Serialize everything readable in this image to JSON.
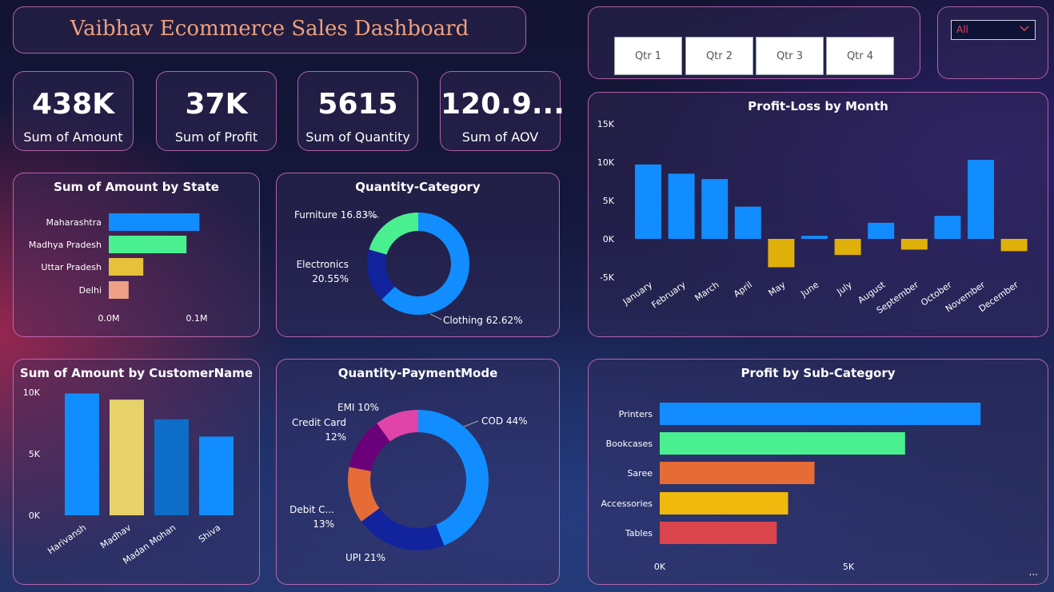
{
  "header": {
    "title": "Vaibhav Ecommerce Sales Dashboard"
  },
  "kpis": [
    {
      "value": "438K",
      "label": "Sum of Amount"
    },
    {
      "value": "37K",
      "label": "Sum of Profit"
    },
    {
      "value": "5615",
      "label": "Sum of Quantity"
    },
    {
      "value": "120.9...",
      "label": "Sum of AOV"
    }
  ],
  "quarters": [
    "Qtr 1",
    "Qtr 2",
    "Qtr 3",
    "Qtr 4"
  ],
  "filter": {
    "selected": "All"
  },
  "titles": {
    "state": "Sum of Amount by State",
    "category": "Quantity-Category",
    "month": "Profit-Loss by Month",
    "customer": "Sum of Amount by CustomerName",
    "payment": "Quantity-PaymentMode",
    "subcat": "Profit by Sub-Category"
  },
  "more_label": "...",
  "chart_data": [
    {
      "id": "state",
      "type": "bar",
      "orientation": "horizontal",
      "title": "Sum of Amount by State",
      "categories": [
        "Maharashtra",
        "Madhya Pradesh",
        "Uttar Pradesh",
        "Delhi"
      ],
      "values": [
        105000,
        90000,
        40000,
        23000
      ],
      "colors": [
        "#118dff",
        "#4af08f",
        "#e6c23a",
        "#eea187"
      ],
      "xticks": [
        "0.0M",
        "0.1M"
      ],
      "xlim": [
        0,
        100000
      ]
    },
    {
      "id": "category",
      "type": "pie",
      "donut": true,
      "title": "Quantity-Category",
      "labels": [
        "Clothing",
        "Furniture",
        "Electronics"
      ],
      "values": [
        62.62,
        16.83,
        20.55
      ],
      "colors": [
        "#118dff",
        "#12239e",
        "#4af08f"
      ],
      "data_labels": [
        [
          "Clothing 62.62%"
        ],
        [
          "Furniture 16.83%"
        ],
        [
          "Electronics",
          "20.55%"
        ]
      ]
    },
    {
      "id": "month",
      "type": "bar",
      "title": "Profit-Loss by Month",
      "categories": [
        "January",
        "February",
        "March",
        "April",
        "May",
        "June",
        "July",
        "August",
        "September",
        "October",
        "November",
        "December"
      ],
      "values": [
        9700,
        8500,
        7800,
        4200,
        -3700,
        400,
        -2100,
        2100,
        -1400,
        3000,
        10300,
        -1600
      ],
      "positive_color": "#118dff",
      "negative_color": "#e0b00b",
      "yticks": [
        [
          "15K",
          15000
        ],
        [
          "10K",
          10000
        ],
        [
          "5K",
          5000
        ],
        [
          "0K",
          0
        ],
        [
          "-5K",
          -5000
        ]
      ],
      "ylim": [
        -5000,
        15000
      ]
    },
    {
      "id": "customer",
      "type": "bar",
      "title": "Sum of Amount by CustomerName",
      "categories": [
        "Harivansh",
        "Madhav",
        "Madan Mohan",
        "Shiva"
      ],
      "values": [
        9900,
        9400,
        7800,
        6400
      ],
      "colors": [
        "#118dff",
        "#e8d36b",
        "#0e6dc7",
        "#118dff"
      ],
      "yticks": [
        [
          "10K",
          10000
        ],
        [
          "5K",
          5000
        ],
        [
          "0K",
          0
        ]
      ],
      "ylim": [
        0,
        10000
      ]
    },
    {
      "id": "payment",
      "type": "pie",
      "donut": true,
      "title": "Quantity-PaymentMode",
      "labels": [
        "COD",
        "UPI",
        "Debit Card",
        "Credit Card",
        "EMI"
      ],
      "values": [
        44,
        21,
        13,
        12,
        10
      ],
      "colors": [
        "#118dff",
        "#12239e",
        "#e66c37",
        "#6b007b",
        "#e044a7"
      ],
      "data_labels": [
        [
          "COD 44%"
        ],
        [
          "UPI 21%"
        ],
        [
          "Debit C...",
          "13%"
        ],
        [
          "Credit Card",
          "12%"
        ],
        [
          "EMI 10%"
        ]
      ]
    },
    {
      "id": "subcat",
      "type": "bar",
      "orientation": "horizontal",
      "title": "Profit by Sub-Category",
      "categories": [
        "Printers",
        "Bookcases",
        "Saree",
        "Accessories",
        "Tables"
      ],
      "values": [
        8500,
        6500,
        4100,
        3400,
        3100
      ],
      "colors": [
        "#118dff",
        "#4af08f",
        "#e66c37",
        "#f0b90e",
        "#d9444d"
      ],
      "xticks": [
        [
          "0K",
          0
        ],
        [
          "5K",
          5000
        ]
      ],
      "xlim": [
        0,
        10000
      ]
    }
  ]
}
